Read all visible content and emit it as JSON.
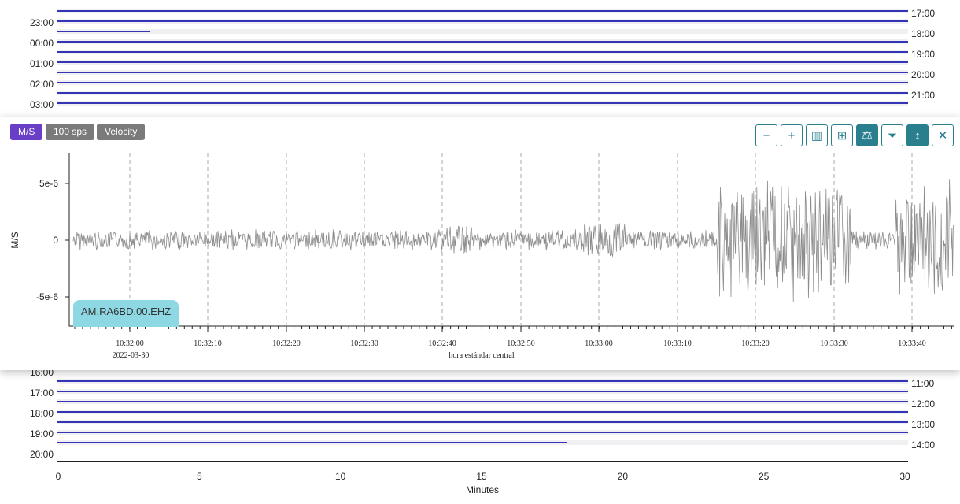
{
  "helicorder_top": {
    "left_labels": [
      "23:00",
      "00:00",
      "01:00",
      "02:00",
      "03:00"
    ],
    "right_labels": [
      "17:00",
      "18:00",
      "19:00",
      "20:00",
      "21:00"
    ]
  },
  "zoom_panel": {
    "units_badge": "M/S",
    "rate_badge": "100 sps",
    "kind_badge": "Velocity",
    "toolbar": [
      {
        "name": "zoom-out-button",
        "icon": "minus-icon",
        "glyph": "−",
        "active": false
      },
      {
        "name": "zoom-in-button",
        "icon": "plus-icon",
        "glyph": "+",
        "active": false
      },
      {
        "name": "spectrum-button",
        "icon": "bar-chart-icon",
        "glyph": "▥",
        "active": false
      },
      {
        "name": "grid-button",
        "icon": "grid-icon",
        "glyph": "⊞",
        "active": false
      },
      {
        "name": "scale-button",
        "icon": "balance-scale-icon",
        "glyph": "⚖",
        "active": true
      },
      {
        "name": "filter-button",
        "icon": "filter-icon",
        "glyph": "⏷",
        "active": false
      },
      {
        "name": "vertical-autoscale-button",
        "icon": "vertical-arrows-icon",
        "glyph": "↕",
        "active": true
      },
      {
        "name": "close-button",
        "icon": "close-icon",
        "glyph": "✕",
        "active": false
      }
    ],
    "station": "AM.RA6BD.00.EHZ",
    "y_axis_title": "M/S",
    "y_ticks": [
      "5e-6",
      "0",
      "-5e-6"
    ],
    "x_ticks": [
      "10:32:00",
      "10:32:10",
      "10:32:20",
      "10:32:30",
      "10:32:40",
      "10:32:50",
      "10:33:00",
      "10:33:10",
      "10:33:20",
      "10:33:30",
      "10:33:40"
    ],
    "x_date": "2022-03-30",
    "x_timezone": "hora estándar central",
    "colors": {
      "trace": "#8c8c8c",
      "accent": "#2a7f8f",
      "units": "#6a3fc8"
    }
  },
  "helicorder_bottom": {
    "left_labels": [
      "16:00",
      "17:00",
      "18:00",
      "19:00",
      "20:00"
    ],
    "right_labels": [
      "11:00",
      "12:00",
      "13:00",
      "14:00"
    ],
    "minute_ticks": [
      "0",
      "5",
      "10",
      "15",
      "20",
      "25",
      "30"
    ],
    "axis_title": "Minutes"
  }
}
